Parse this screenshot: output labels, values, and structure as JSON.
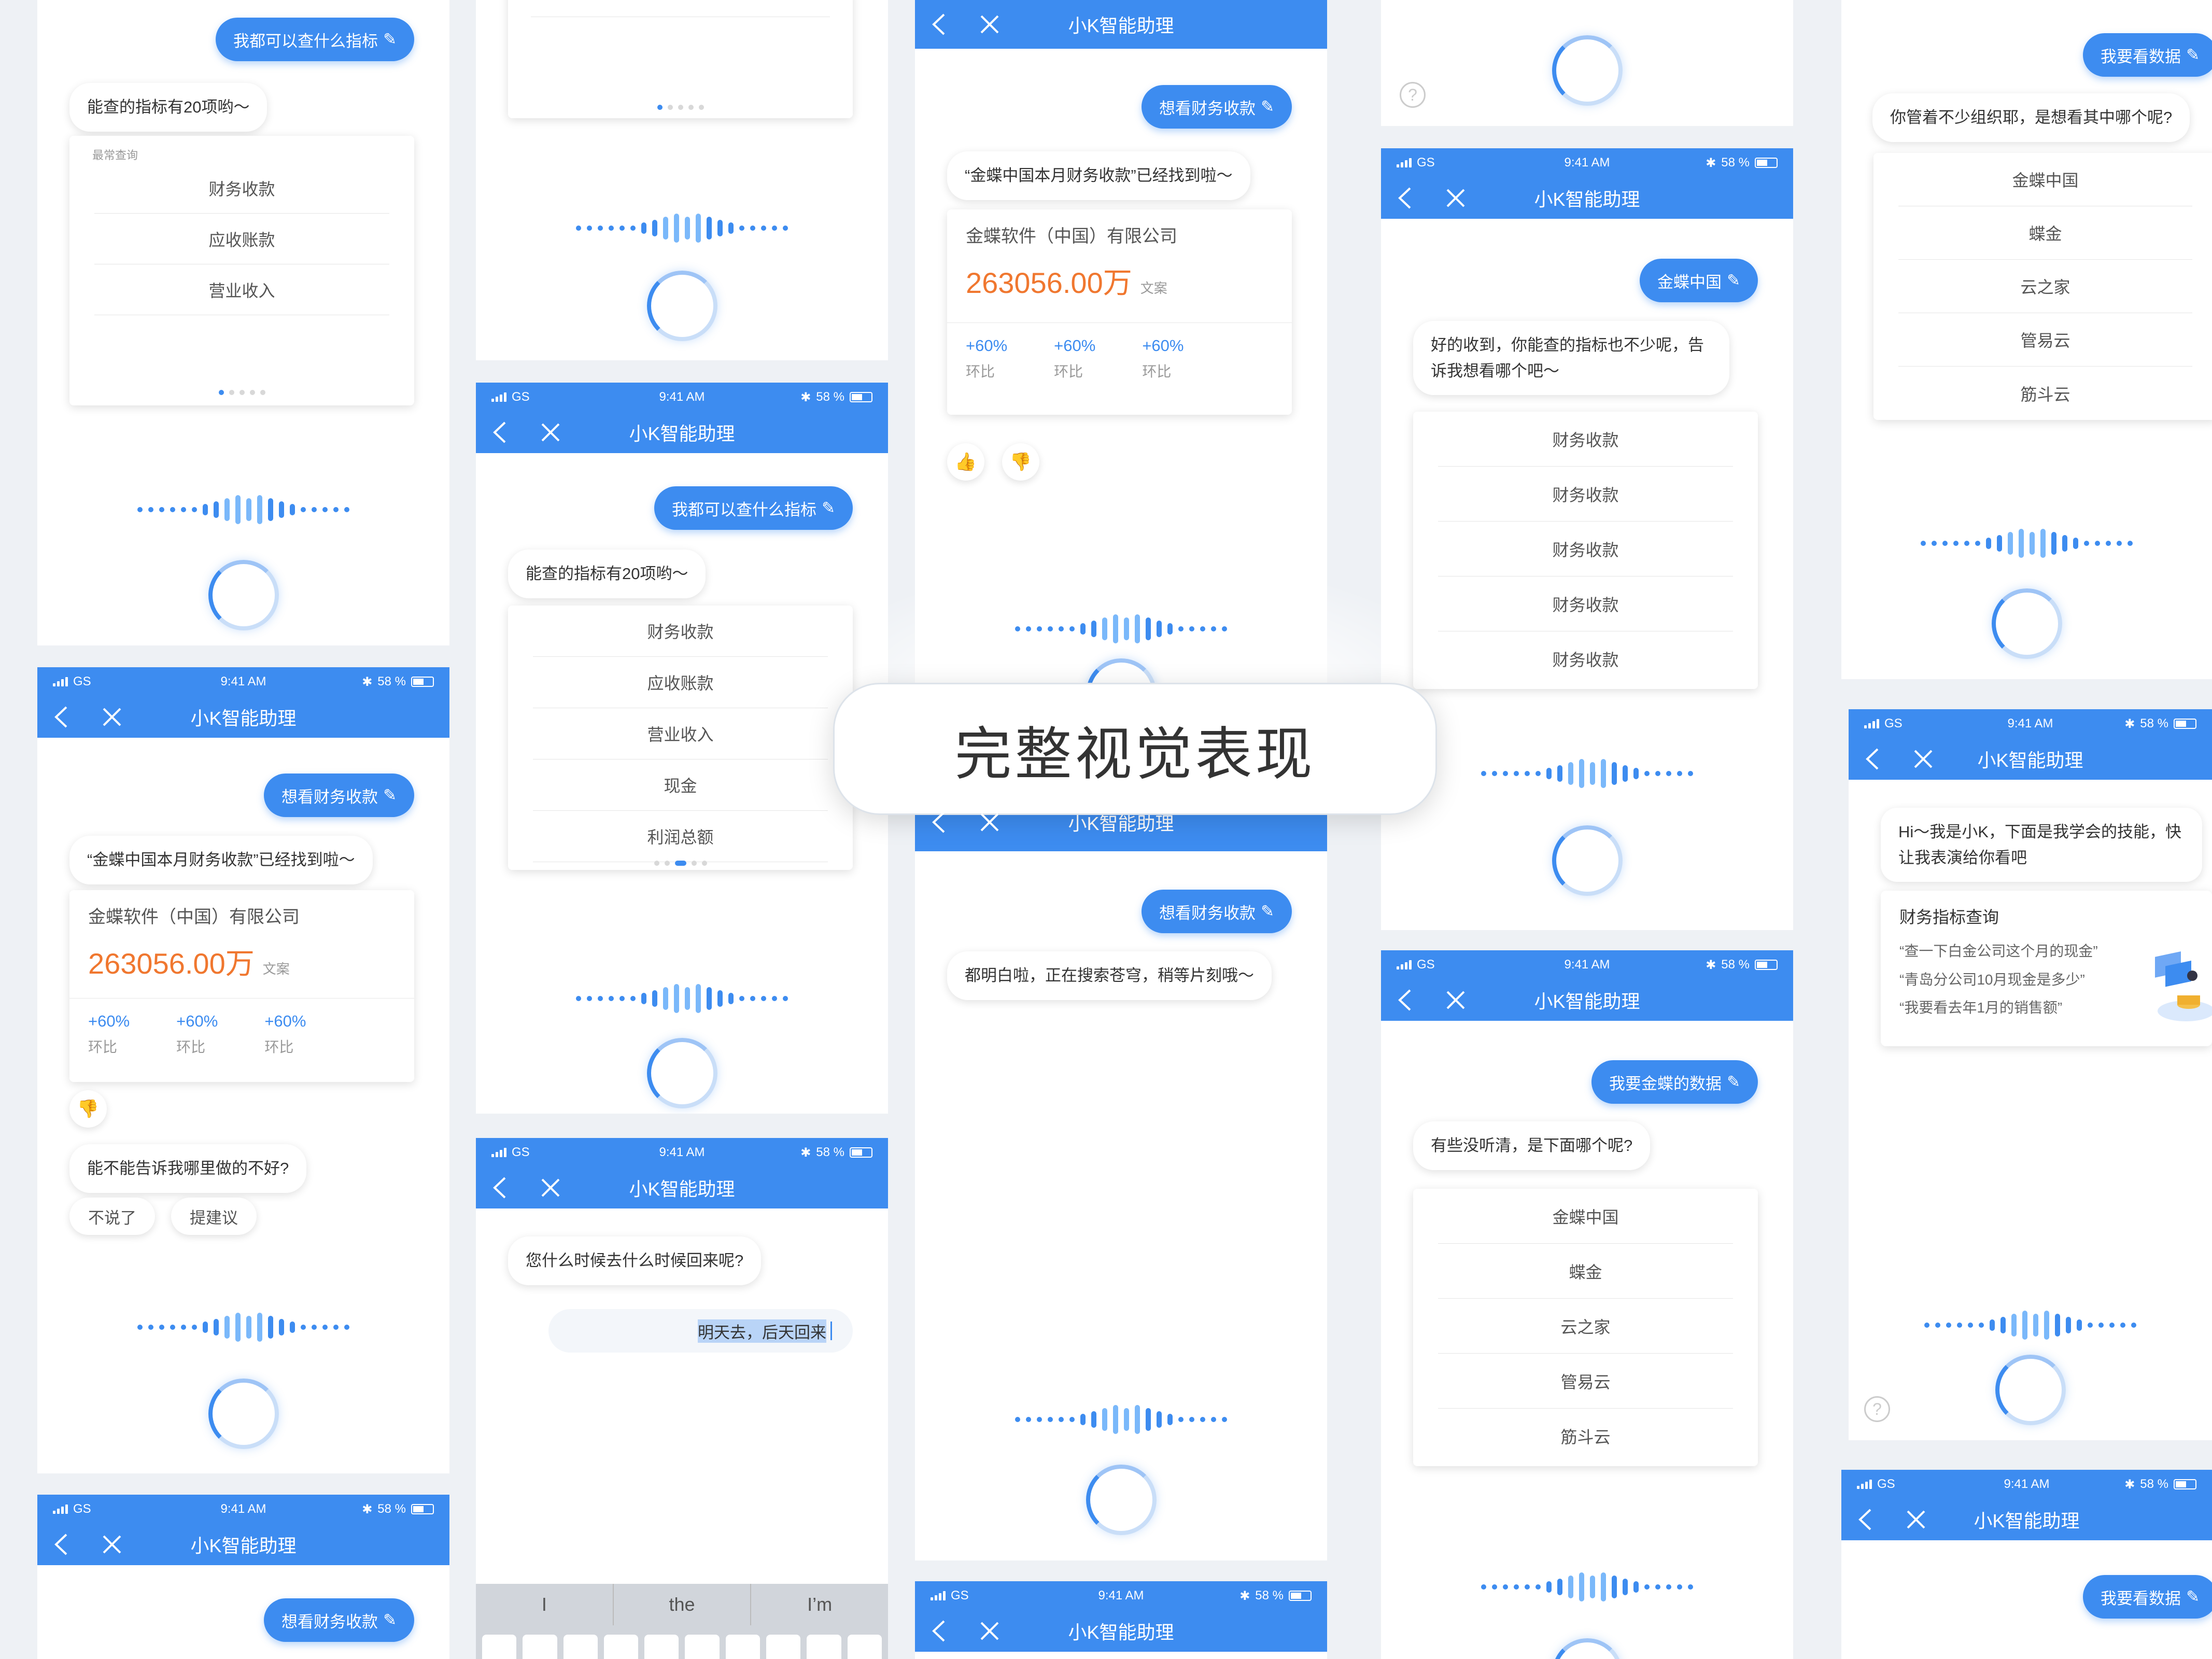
{
  "header": {
    "title": "小K智能助理",
    "time": "9:41 AM",
    "carrier": "GS",
    "battery": "58 %"
  },
  "center": {
    "label": "完整视觉表现"
  },
  "queries": {
    "indicators": "我都可以查什么指标",
    "finance": "想看财务收款",
    "jindie_china": "金蝶中国",
    "jindie_data": "我要金蝶的数据",
    "want_data": "我要看数据"
  },
  "replies": {
    "count": "能查的指标有20项哟～",
    "found": "“金蝶中国本月财务收款”已经找到啦～",
    "searching": "都明白啦，正在搜索苍穹，稍等片刻哦～",
    "got_it": "好的收到，你能查的指标也不少呢，告诉我想看哪个吧～",
    "unclear": "有些没听清，是下面哪个呢?",
    "orgs": "你管着不少组织耶，是想看其中哪个呢?",
    "ask_feedback": "能不能告诉我哪里做的不好?",
    "when": "您什么时候去什么时候回来呢?",
    "intro": "Hi～我是小K，下面是我学会的技能，快让我表演给你看吧"
  },
  "indicator_menu": {
    "section": "最常查询",
    "items": [
      "财务收款",
      "应收账款",
      "营业收入",
      "现金",
      "利润总额"
    ]
  },
  "finance_card": {
    "company": "金蝶软件（中国）有限公司",
    "amount": "263056.00万",
    "unit": "文案",
    "stats": [
      {
        "value": "+60%",
        "label": "环比"
      },
      {
        "value": "+60%",
        "label": "环比"
      },
      {
        "value": "+60%",
        "label": "环比"
      }
    ]
  },
  "repeat_list": [
    "财务收款",
    "财务收款",
    "财务收款",
    "财务收款",
    "财务收款"
  ],
  "orgs_list": [
    "金蝶中国",
    "蝶金",
    "云之家",
    "管易云",
    "筋斗云"
  ],
  "feedback": {
    "skip": "不说了",
    "suggest": "提建议"
  },
  "input": {
    "value": "明天去，后天回来"
  },
  "keyboard": {
    "suggestions": [
      "I",
      "the",
      "I’m"
    ]
  },
  "skill": {
    "title": "财务指标查询",
    "examples": [
      "“查一下白金公司这个月的现金”",
      "“青岛分公司10月现金是多少”",
      "“我要看去年1月的销售额”"
    ]
  },
  "icons": {
    "like": "thumbs-up-icon",
    "dislike": "thumbs-down-icon",
    "help": "question-icon",
    "edit": "pencil-icon"
  },
  "colors": {
    "accent": "#3d8cf0",
    "amount": "#f0772f"
  }
}
